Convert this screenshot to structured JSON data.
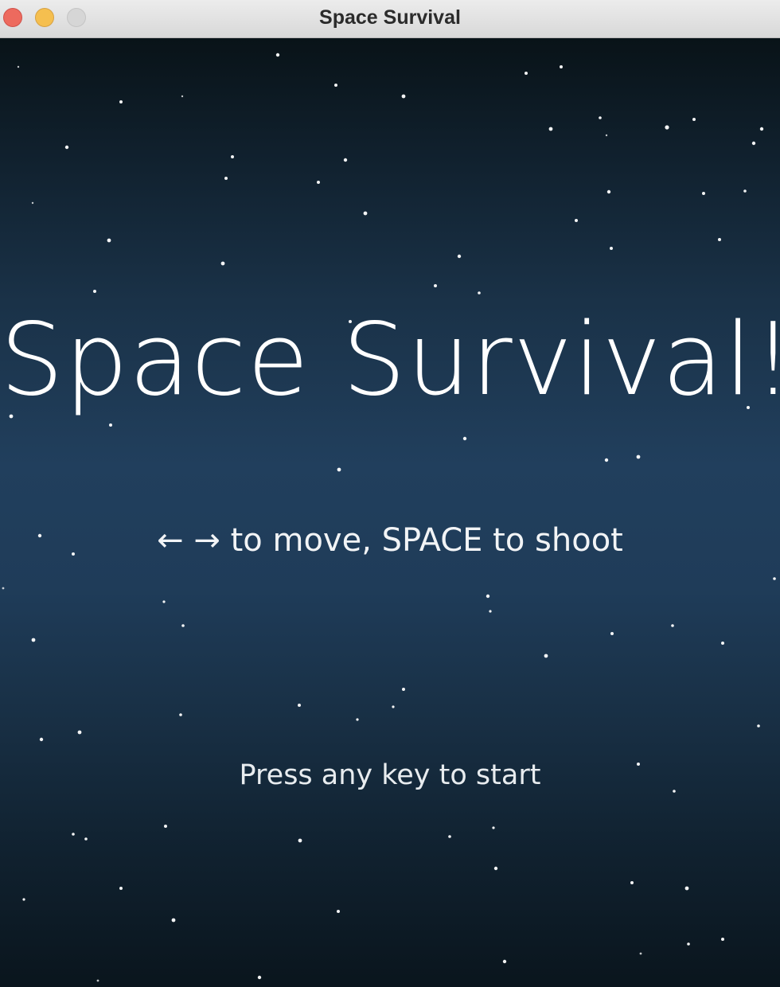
{
  "window": {
    "title": "Space Survival"
  },
  "game": {
    "title": "Space Survival!",
    "instructions": "← → to move, SPACE to shoot",
    "start_prompt": "Press any key to start"
  },
  "colors": {
    "background_top": "#091318",
    "background_mid": "#213f5d",
    "text": "#ffffff",
    "star": "#ffffff"
  }
}
